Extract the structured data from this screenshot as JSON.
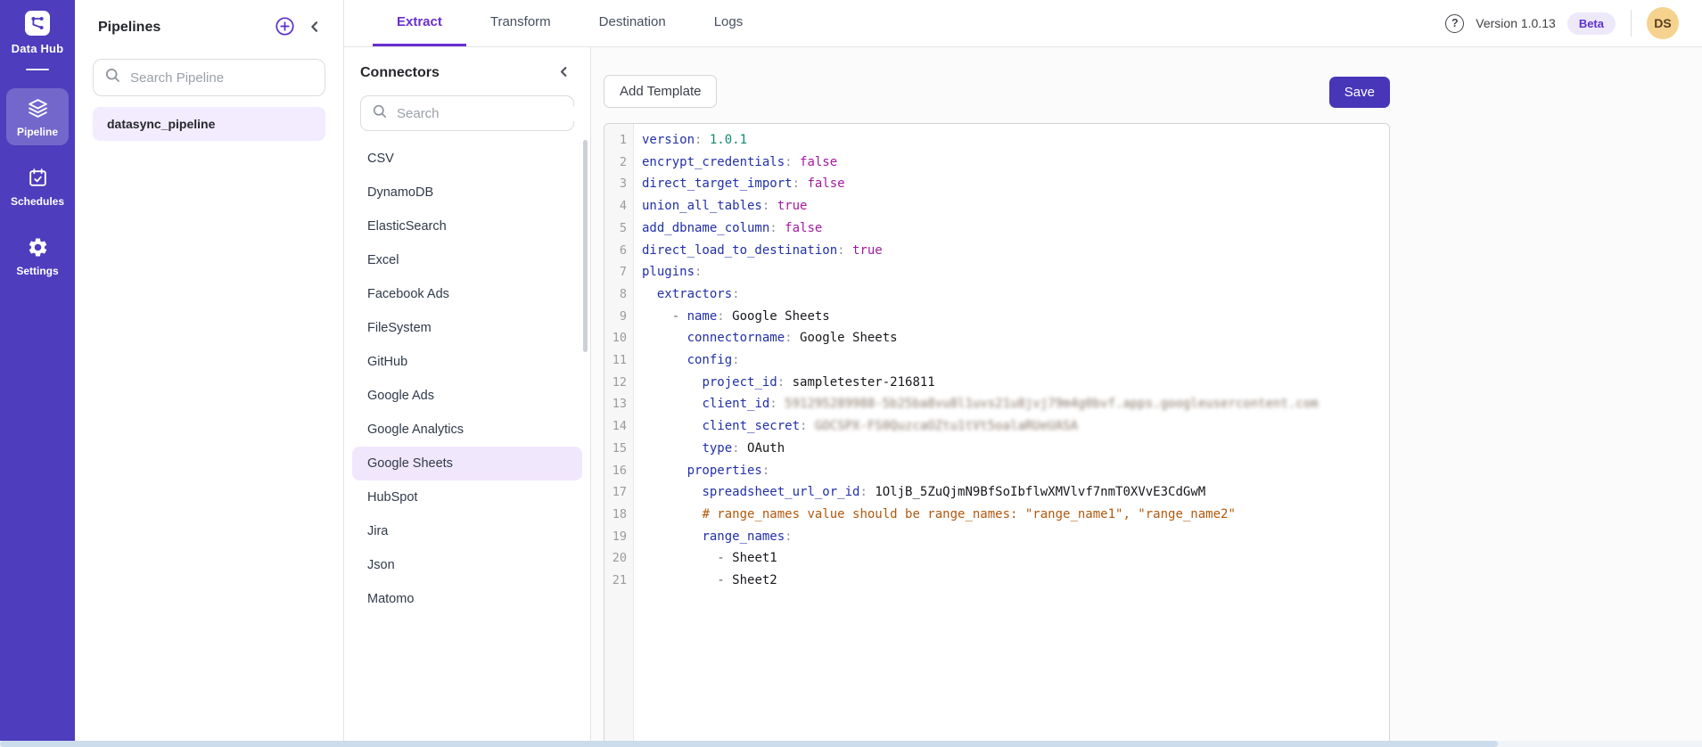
{
  "app": {
    "name": "Data Hub",
    "version": "Version 1.0.13",
    "beta": "Beta",
    "avatar_initials": "DS"
  },
  "colors": {
    "brand_purple": "#4e3dbd",
    "accent_purple": "#6a2fd0",
    "save_button": "#4836b9",
    "beta_badge_bg": "#eee8fb",
    "avatar_bg": "#f6d28f",
    "selected_row_bg": "#f1e7fc",
    "code_key": "#2230a8",
    "code_boolean": "#a21a9f",
    "code_number": "#108a6e",
    "code_comment": "#b2590e"
  },
  "sidebar": {
    "items": [
      {
        "label": "Pipeline",
        "icon": "layers-icon",
        "active": true
      },
      {
        "label": "Schedules",
        "icon": "calendar-check-icon",
        "active": false
      },
      {
        "label": "Settings",
        "icon": "gear-icon",
        "active": false
      }
    ]
  },
  "pipelines_panel": {
    "title": "Pipelines",
    "search_placeholder": "Search Pipeline",
    "items": [
      {
        "name": "datasync_pipeline",
        "selected": true
      }
    ]
  },
  "tabs": [
    {
      "label": "Extract",
      "active": true
    },
    {
      "label": "Transform",
      "active": false
    },
    {
      "label": "Destination",
      "active": false
    },
    {
      "label": "Logs",
      "active": false
    }
  ],
  "connectors_panel": {
    "title": "Connectors",
    "search_placeholder": "Search",
    "selected": "Google Sheets",
    "items": [
      "CSV",
      "DynamoDB",
      "ElasticSearch",
      "Excel",
      "Facebook Ads",
      "FileSystem",
      "GitHub",
      "Google Ads",
      "Google Analytics",
      "Google Sheets",
      "HubSpot",
      "Jira",
      "Json",
      "Matomo"
    ]
  },
  "toolbar": {
    "add_template": "Add Template",
    "save": "Save"
  },
  "editor": {
    "language": "yaml",
    "lines": [
      [
        [
          "k",
          "version"
        ],
        [
          "p",
          ": "
        ],
        [
          "n",
          "1.0.1"
        ]
      ],
      [
        [
          "k",
          "encrypt_credentials"
        ],
        [
          "p",
          ": "
        ],
        [
          "b",
          "false"
        ]
      ],
      [
        [
          "k",
          "direct_target_import"
        ],
        [
          "p",
          ": "
        ],
        [
          "b",
          "false"
        ]
      ],
      [
        [
          "k",
          "union_all_tables"
        ],
        [
          "p",
          ": "
        ],
        [
          "b",
          "true"
        ]
      ],
      [
        [
          "k",
          "add_dbname_column"
        ],
        [
          "p",
          ": "
        ],
        [
          "b",
          "false"
        ]
      ],
      [
        [
          "k",
          "direct_load_to_destination"
        ],
        [
          "p",
          ": "
        ],
        [
          "b",
          "true"
        ]
      ],
      [
        [
          "k",
          "plugins"
        ],
        [
          "p",
          ":"
        ]
      ],
      [
        [
          "s",
          "  "
        ],
        [
          "k",
          "extractors"
        ],
        [
          "p",
          ":"
        ]
      ],
      [
        [
          "s",
          "    "
        ],
        [
          "d",
          "- "
        ],
        [
          "k",
          "name"
        ],
        [
          "p",
          ": "
        ],
        [
          "s",
          "Google Sheets"
        ]
      ],
      [
        [
          "s",
          "      "
        ],
        [
          "k",
          "connectorname"
        ],
        [
          "p",
          ": "
        ],
        [
          "s",
          "Google Sheets"
        ]
      ],
      [
        [
          "s",
          "      "
        ],
        [
          "k",
          "config"
        ],
        [
          "p",
          ":"
        ]
      ],
      [
        [
          "s",
          "        "
        ],
        [
          "k",
          "project_id"
        ],
        [
          "p",
          ": "
        ],
        [
          "s",
          "sampletester-216811"
        ]
      ],
      [
        [
          "s",
          "        "
        ],
        [
          "k",
          "client_id"
        ],
        [
          "p",
          ": "
        ],
        [
          "r",
          "591295289988-5b25ba8vu8l1uvs21u8jvj79m4g0bvf.apps.googleusercontent.com"
        ]
      ],
      [
        [
          "s",
          "        "
        ],
        [
          "k",
          "client_secret"
        ],
        [
          "p",
          ": "
        ],
        [
          "r",
          "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"
        ]
      ],
      [
        [
          "s",
          "        "
        ],
        [
          "k",
          "type"
        ],
        [
          "p",
          ": "
        ],
        [
          "s",
          "OAuth"
        ]
      ],
      [
        [
          "s",
          "      "
        ],
        [
          "k",
          "properties"
        ],
        [
          "p",
          ":"
        ]
      ],
      [
        [
          "s",
          "        "
        ],
        [
          "k",
          "spreadsheet_url_or_id"
        ],
        [
          "p",
          ": "
        ],
        [
          "s",
          "1OljB_5ZuQjmN9BfSoIbflwXMVlvf7nmT0XVvE3CdGwM"
        ]
      ],
      [
        [
          "s",
          "        "
        ],
        [
          "c",
          "# range_names value should be range_names: \"range_name1\", \"range_name2\""
        ]
      ],
      [
        [
          "s",
          "        "
        ],
        [
          "k",
          "range_names"
        ],
        [
          "p",
          ":"
        ]
      ],
      [
        [
          "s",
          "          "
        ],
        [
          "d",
          "- "
        ],
        [
          "s",
          "Sheet1"
        ]
      ],
      [
        [
          "s",
          "          "
        ],
        [
          "d",
          "- "
        ],
        [
          "s",
          "Sheet2"
        ]
      ]
    ]
  }
}
